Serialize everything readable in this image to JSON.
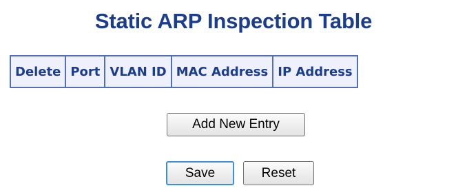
{
  "page": {
    "title": "Static ARP Inspection Table"
  },
  "table": {
    "columns": [
      "Delete",
      "Port",
      "VLAN ID",
      "MAC Address",
      "IP Address"
    ],
    "rows": []
  },
  "buttons": {
    "add_new_entry": "Add New Entry",
    "save": "Save",
    "reset": "Reset"
  },
  "colors": {
    "title": "#1a3d8f",
    "header_text": "#1a3d8f",
    "header_border": "#4f70b8",
    "header_bg": "#eef1fb",
    "focus_border": "#3a8ee6"
  }
}
